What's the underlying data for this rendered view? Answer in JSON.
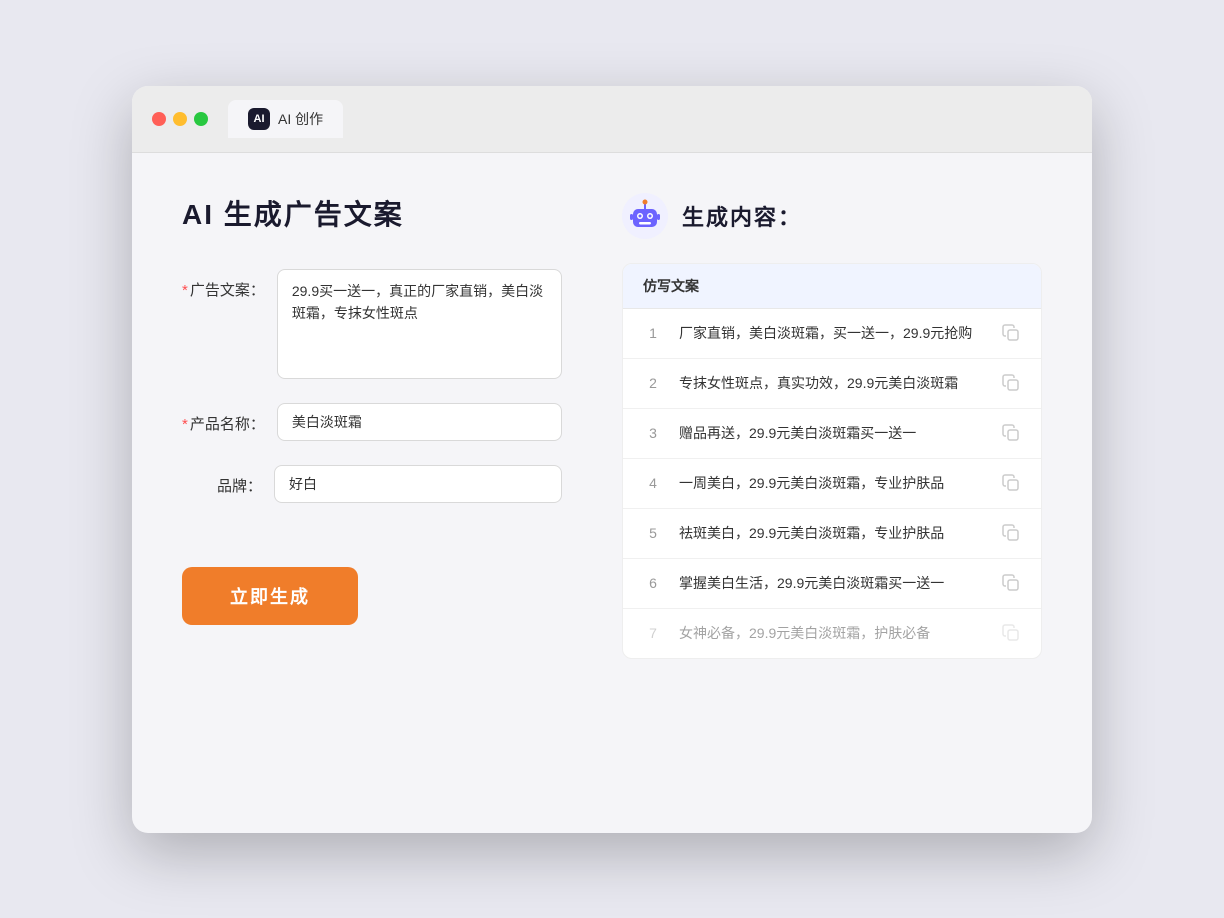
{
  "browser": {
    "tab_label": "AI 创作",
    "tab_icon": "AI"
  },
  "left_panel": {
    "page_title": "AI 生成广告文案",
    "form": {
      "ad_copy_label": "广告文案：",
      "ad_copy_required": "*",
      "ad_copy_value": "29.9买一送一，真正的厂家直销，美白淡斑霜，专抹女性斑点",
      "product_name_label": "产品名称：",
      "product_name_required": "*",
      "product_name_value": "美白淡斑霜",
      "brand_label": "品牌：",
      "brand_value": "好白"
    },
    "generate_button_label": "立即生成"
  },
  "right_panel": {
    "title": "生成内容：",
    "table_header": "仿写文案",
    "results": [
      {
        "id": 1,
        "text": "厂家直销，美白淡斑霜，买一送一，29.9元抢购"
      },
      {
        "id": 2,
        "text": "专抹女性斑点，真实功效，29.9元美白淡斑霜"
      },
      {
        "id": 3,
        "text": "赠品再送，29.9元美白淡斑霜买一送一"
      },
      {
        "id": 4,
        "text": "一周美白，29.9元美白淡斑霜，专业护肤品"
      },
      {
        "id": 5,
        "text": "祛斑美白，29.9元美白淡斑霜，专业护肤品"
      },
      {
        "id": 6,
        "text": "掌握美白生活，29.9元美白淡斑霜买一送一"
      },
      {
        "id": 7,
        "text": "女神必备，29.9元美白淡斑霜，护肤必备",
        "faded": true
      }
    ]
  }
}
